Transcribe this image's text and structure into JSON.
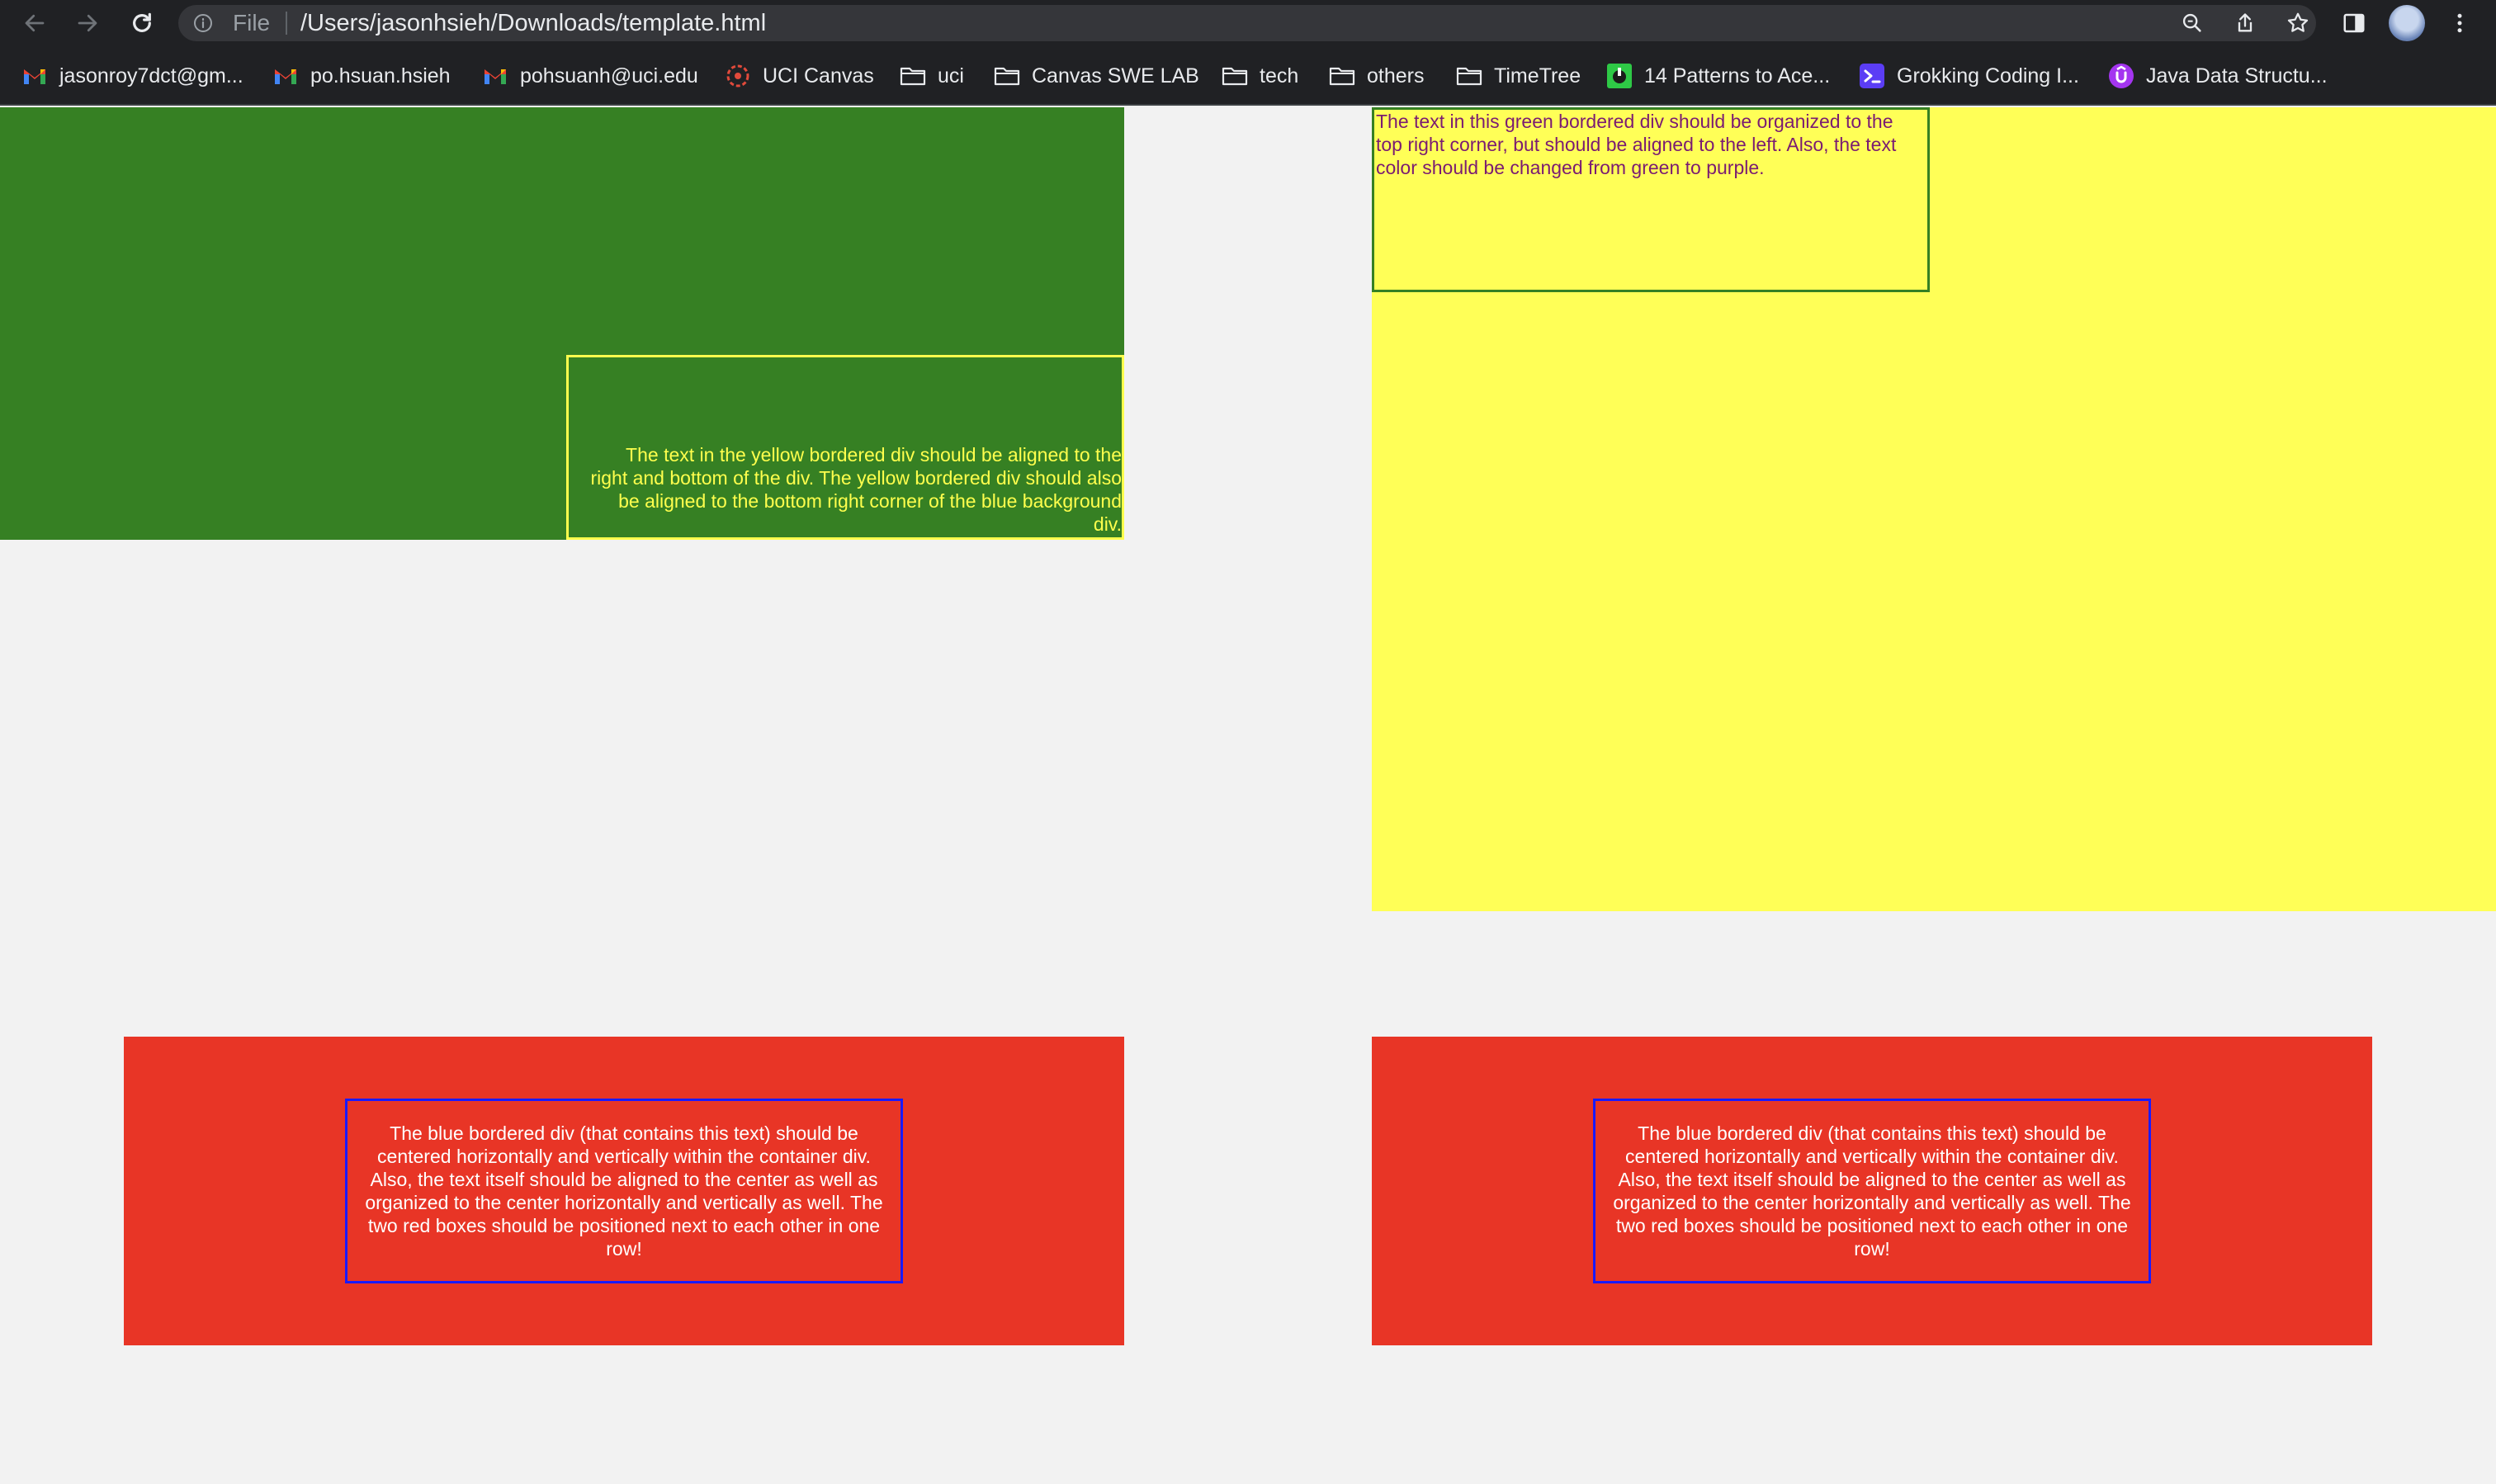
{
  "browser": {
    "omnibox": {
      "scheme_label": "File",
      "url": "/Users/jasonhsieh/Downloads/template.html"
    },
    "bookmarks": [
      {
        "label": "jasonroy7dct@gm...",
        "icon": "gmail-icon"
      },
      {
        "label": "po.hsuan.hsieh",
        "icon": "gmail-icon"
      },
      {
        "label": "pohsuanh@uci.edu",
        "icon": "gmail-icon"
      },
      {
        "label": "UCI Canvas",
        "icon": "canvas-icon"
      },
      {
        "label": "uci",
        "icon": "folder-icon"
      },
      {
        "label": "Canvas SWE LAB",
        "icon": "folder-icon"
      },
      {
        "label": "tech",
        "icon": "folder-icon"
      },
      {
        "label": "others",
        "icon": "folder-icon"
      },
      {
        "label": "TimeTree",
        "icon": "folder-icon"
      },
      {
        "label": "14 Patterns to Ace...",
        "icon": "hackernoon-icon"
      },
      {
        "label": "Grokking Coding I...",
        "icon": "terminal-icon"
      },
      {
        "label": "Java Data Structu...",
        "icon": "udemy-icon"
      }
    ]
  },
  "page": {
    "yellow_bordered_text": "The text in the yellow bordered div should be aligned to the right and bottom of the div. The yellow bordered div should also be aligned to the bottom right corner of the blue background div.",
    "green_bordered_text": "The text in this green bordered div should be organized to the top right corner, but should be aligned to the left. Also, the text color should be changed from green to purple.",
    "red_left_text": "The blue bordered div (that contains this text) should be centered horizontally and vertically within the container div. Also, the text itself should be aligned to the center as well as organized to the center horizontally and vertically as well. The two red boxes should be positioned next to each other in one row!",
    "red_right_text": "The blue bordered div (that contains this text) should be centered horizontally and vertically within the container div. Also, the text itself should be aligned to the center as well as organized to the center horizontally and vertically as well. The two red boxes should be positioned next to each other in one row!"
  },
  "colors": {
    "green_bg": "#368023",
    "yellow_bg": "#ffff57",
    "red_bg": "#e83526",
    "blue_border": "#1a1aff",
    "purple_text": "#7a1b72"
  }
}
